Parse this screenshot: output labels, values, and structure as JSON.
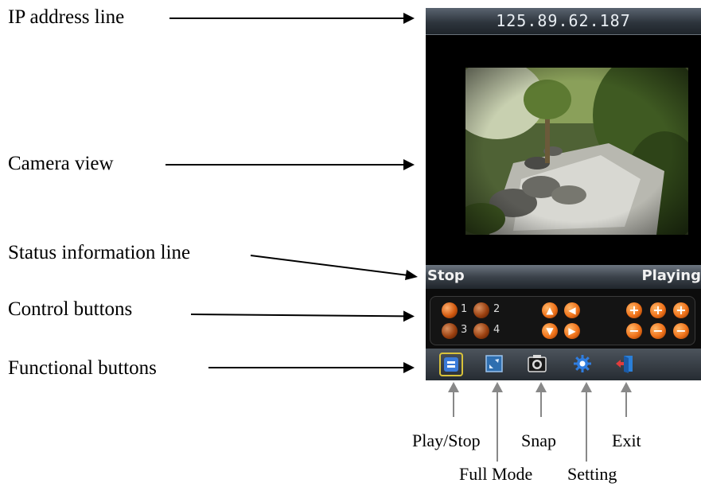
{
  "annotations": {
    "ip_address_line": "IP address line",
    "camera_view": "Camera view",
    "status_information_line": "Status information line",
    "control_buttons": "Control buttons",
    "functional_buttons": "Functional buttons",
    "play_stop": "Play/Stop",
    "full_mode": "Full Mode",
    "snap": "Snap",
    "setting": "Setting",
    "exit": "Exit"
  },
  "screen": {
    "ip_address": "125.89.62.187",
    "status_left": "Stop",
    "status_right": "Playing",
    "presets": [
      "1",
      "2",
      "3",
      "4"
    ],
    "ptz_icons": [
      "up-arrow-icon",
      "left-arrow-icon",
      "down-arrow-icon",
      "right-arrow-icon"
    ],
    "zoom_icons": [
      "plus-icon",
      "minus-icon"
    ],
    "function_icons": [
      "play-stop-icon",
      "full-mode-icon",
      "snap-icon",
      "setting-gear-icon",
      "exit-icon"
    ]
  },
  "colors": {
    "button_orange": "#f0721a",
    "selected_outline": "#d8c23a",
    "bar_dark": "#262c32"
  }
}
